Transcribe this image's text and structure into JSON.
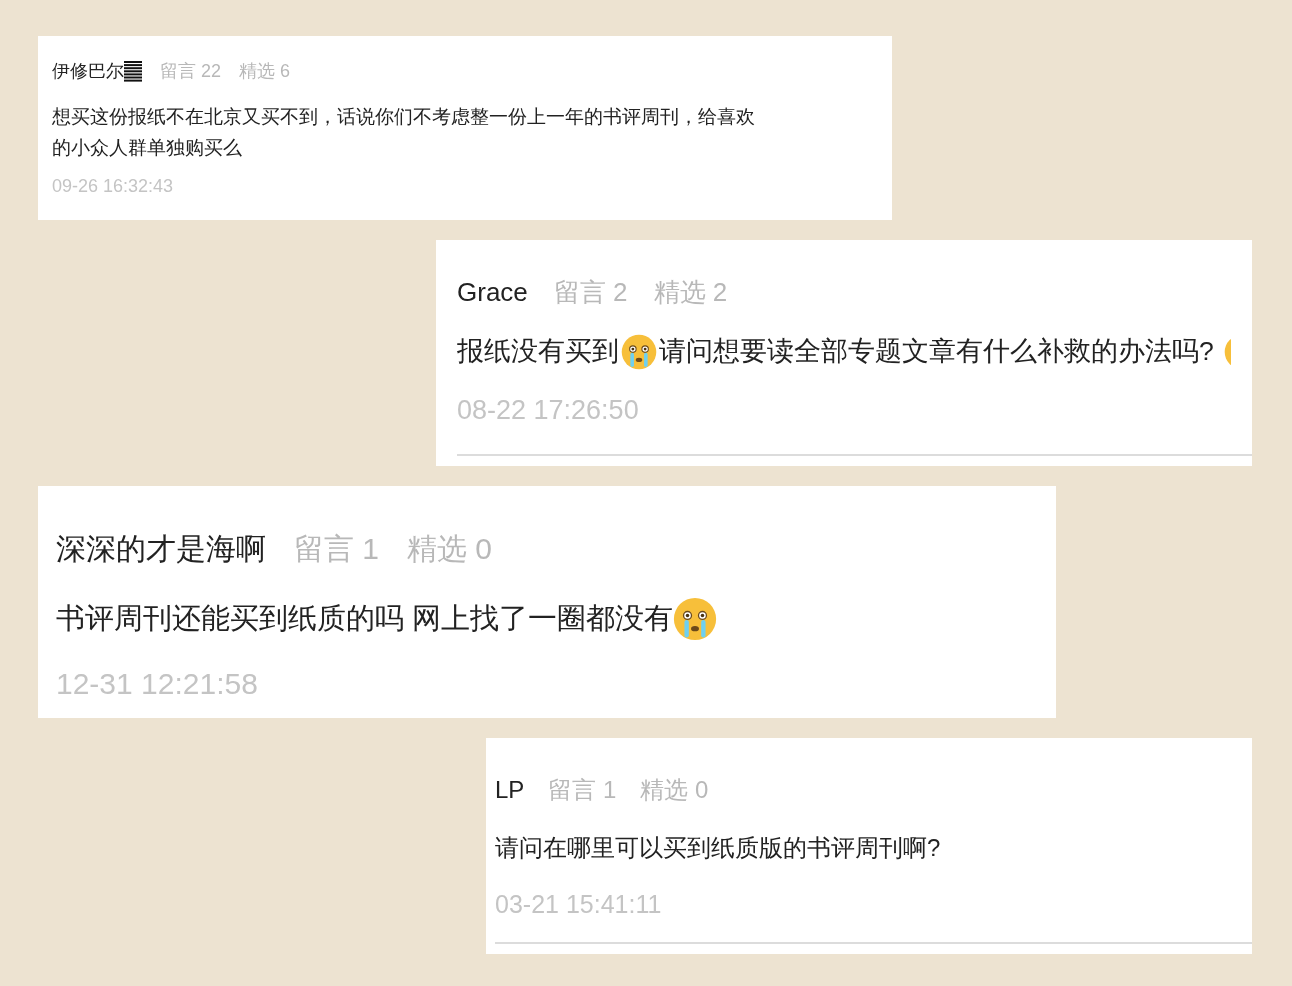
{
  "comments": [
    {
      "name": "伊修巴尔",
      "name_badge": true,
      "replies": "留言 22",
      "picks": "精选 6",
      "body": [
        {
          "kind": "text",
          "text": "想买这份报纸不在北京又买不到，话说你们不考虑整一份上一年的书评周刊，给喜欢的小众人群单独购买么"
        }
      ],
      "time": "09-26 16:32:43",
      "divider": false
    },
    {
      "name": "Grace",
      "name_badge": false,
      "replies": "留言 2",
      "picks": "精选 2",
      "body": [
        {
          "kind": "text",
          "text": "报纸没有买到"
        },
        {
          "kind": "emoji"
        },
        {
          "kind": "text",
          "text": "请问想要读全部专题文章有什么补救的办法吗?"
        },
        {
          "kind": "emoji_cut"
        }
      ],
      "time": "08-22 17:26:50",
      "divider": true
    },
    {
      "name": "深深的才是海啊",
      "name_badge": false,
      "replies": "留言 1",
      "picks": "精选 0",
      "body": [
        {
          "kind": "text",
          "text": "书评周刊还能买到纸质的吗 网上找了一圈都没有"
        },
        {
          "kind": "emoji"
        }
      ],
      "time": "12-31 12:21:58",
      "divider": false
    },
    {
      "name": "LP",
      "name_badge": false,
      "replies": "留言 1",
      "picks": "精选 0",
      "body": [
        {
          "kind": "text",
          "text": "请问在哪里可以买到纸质版的书评周刊啊?"
        }
      ],
      "time": "03-21 15:41:11",
      "divider": true
    }
  ]
}
